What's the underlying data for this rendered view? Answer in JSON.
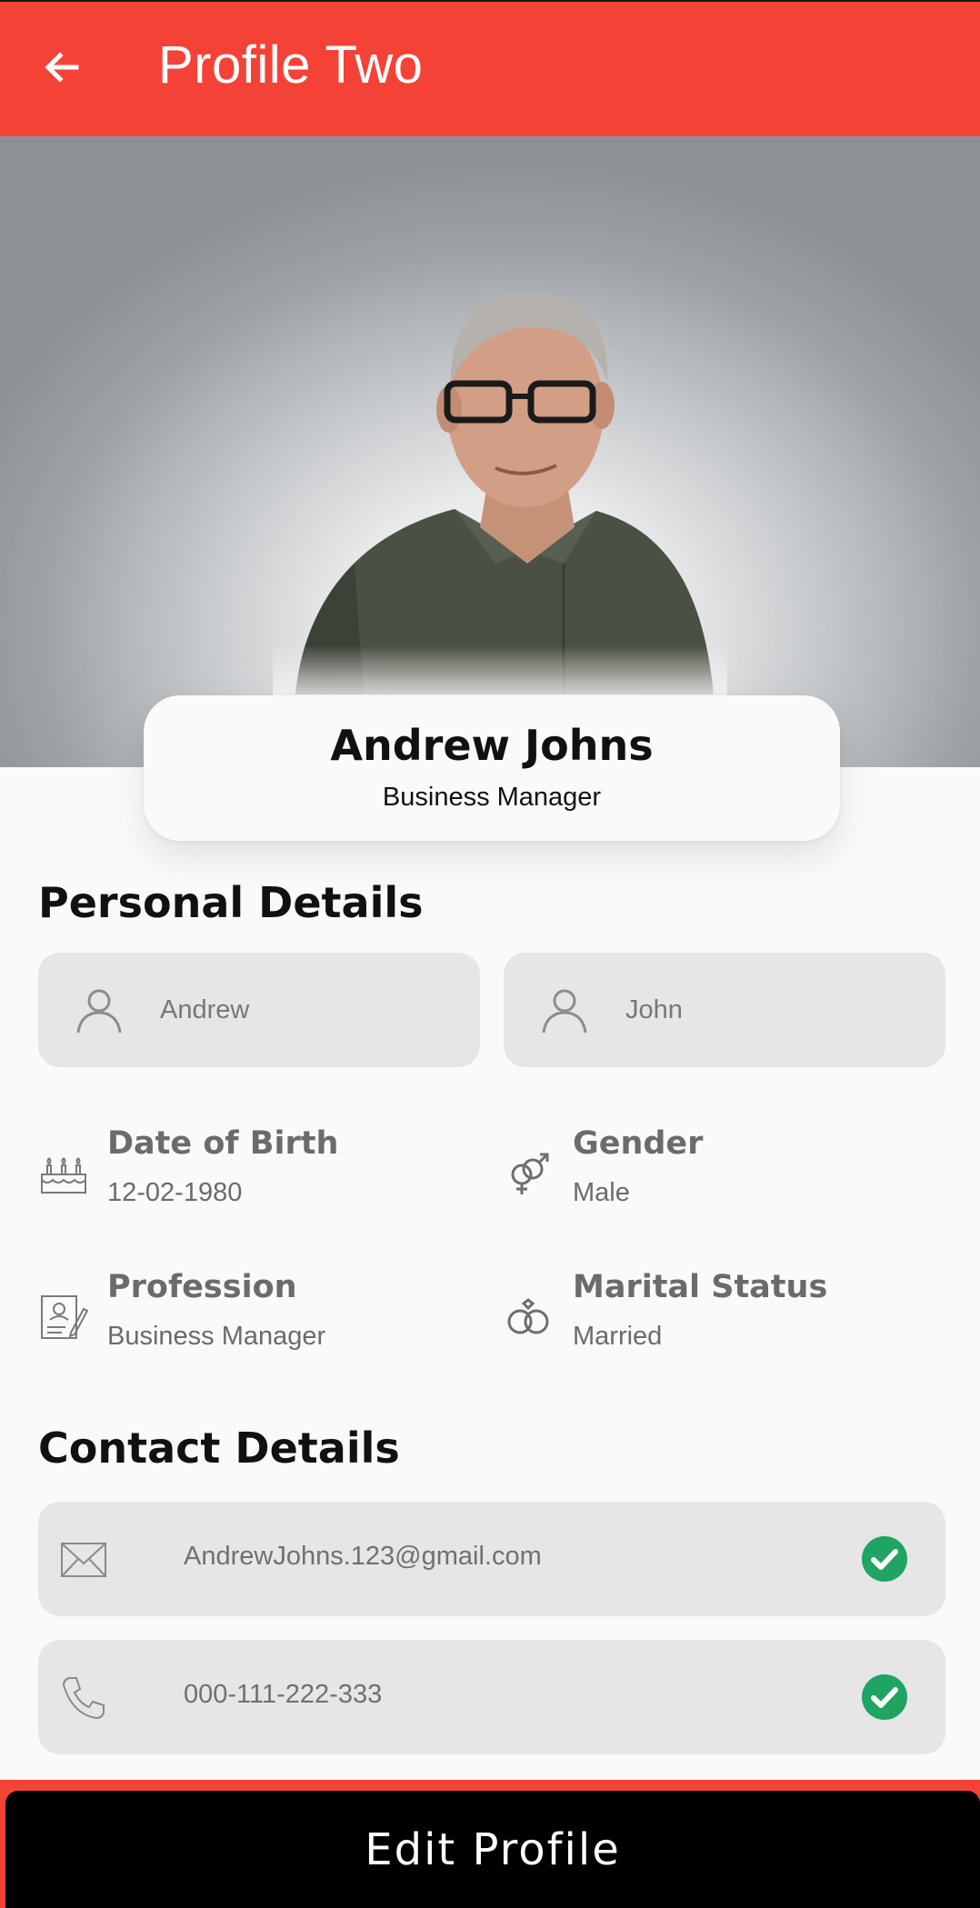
{
  "appbar": {
    "title": "Profile Two",
    "back_icon": "arrow-left-icon",
    "color": "#f44336"
  },
  "profile": {
    "name": "Andrew Johns",
    "role": "Business Manager"
  },
  "personal": {
    "title": "Personal Details",
    "first_name": "Andrew",
    "last_name": "John",
    "dob_label": "Date of Birth",
    "dob_value": "12-02-1980",
    "gender_label": "Gender",
    "gender_value": "Male",
    "profession_label": "Profession",
    "profession_value": "Business Manager",
    "marital_label": "Marital Status",
    "marital_value": "Married"
  },
  "contact": {
    "title": "Contact Details",
    "email": "AndrewJohns.123@gmail.com",
    "phone": "000-111-222-333",
    "verified_color": "#1fa462"
  },
  "actions": {
    "edit_label": "Edit Profile"
  }
}
